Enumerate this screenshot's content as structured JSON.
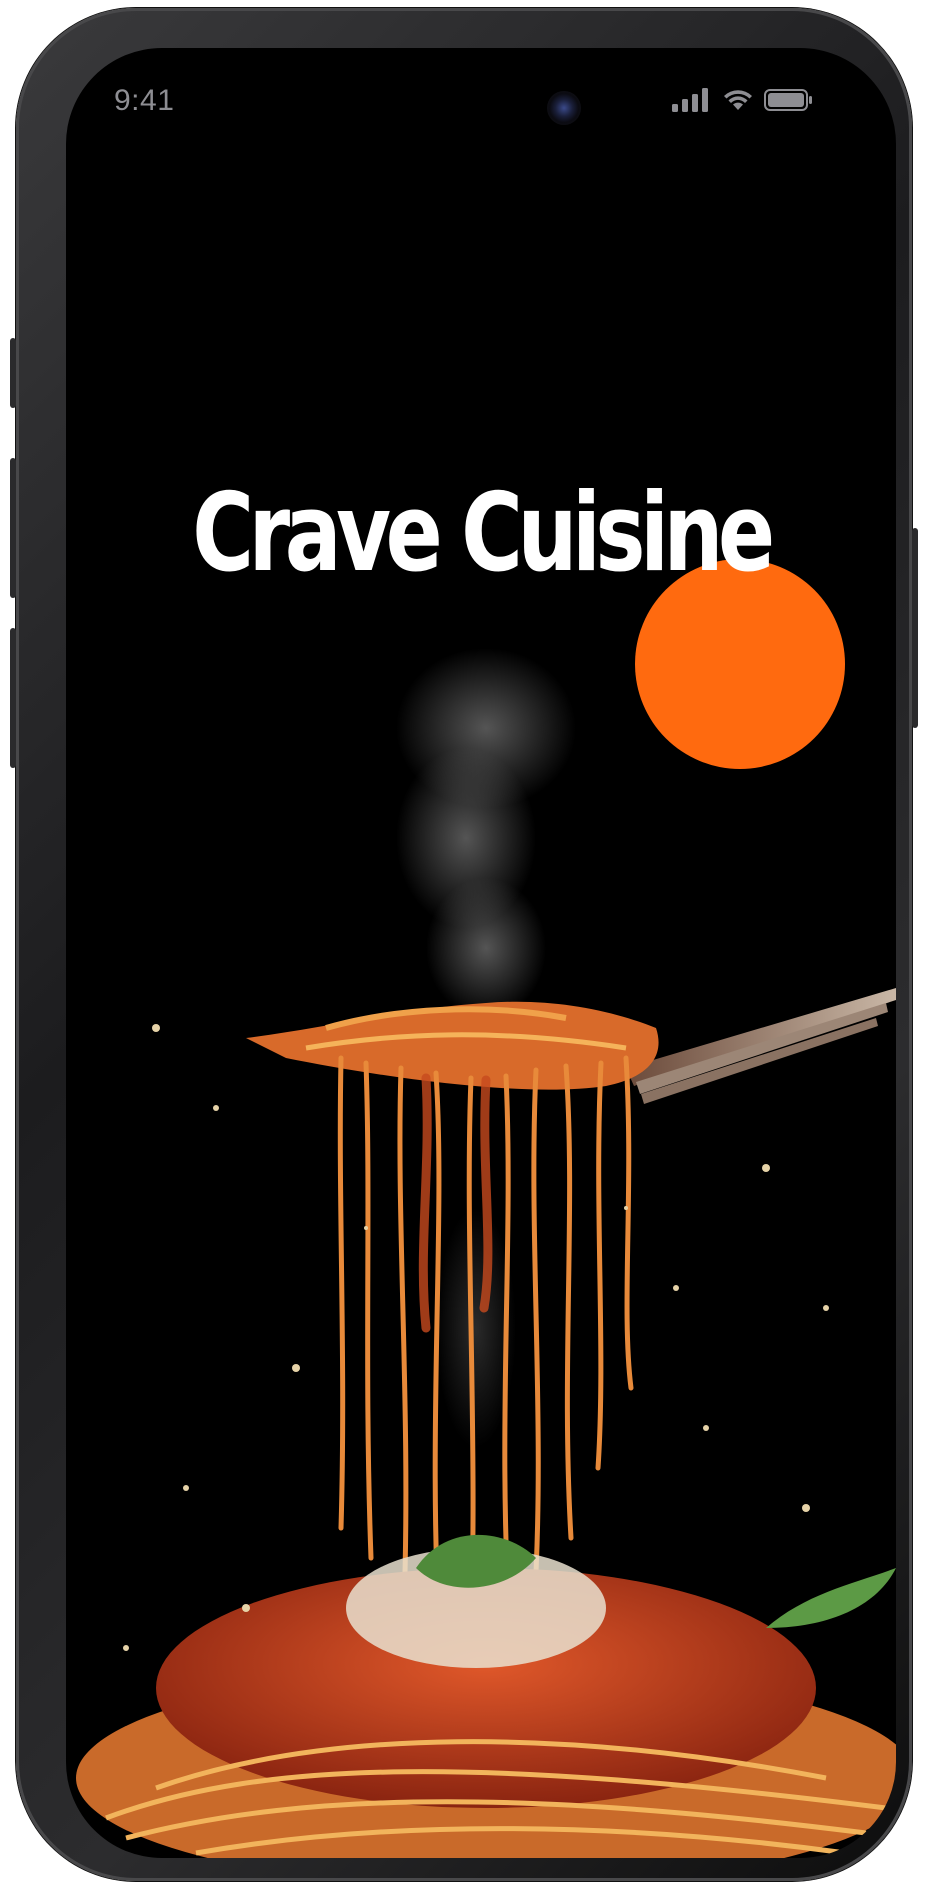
{
  "status_bar": {
    "time": "9:41",
    "icons": [
      "cellular-signal-icon",
      "wifi-icon",
      "battery-icon"
    ]
  },
  "splash": {
    "title": "Crave Cuisine",
    "image": "spaghetti-on-fork-illustration"
  },
  "colors": {
    "background": "#000000",
    "accent": "#ff6a0f",
    "title_text": "#ffffff",
    "status_text": "#8e8e93"
  }
}
